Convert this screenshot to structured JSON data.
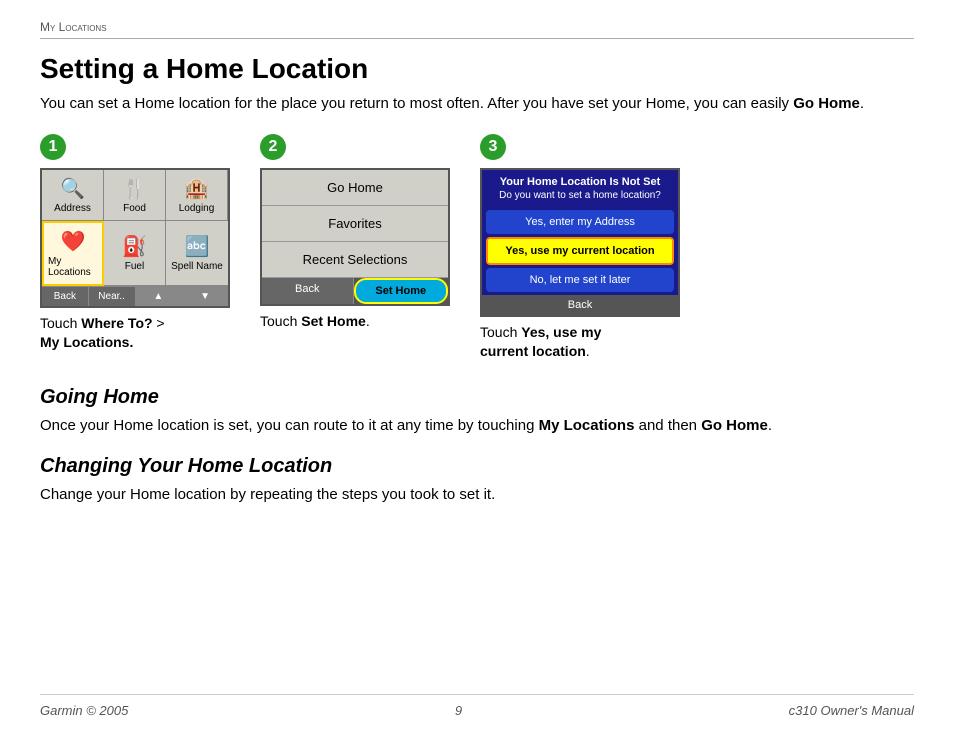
{
  "breadcrumb": "My Locations",
  "title": "Setting a Home Location",
  "intro": "You can set a Home location for the place you return to most often. After you have set your Home, you can easily ",
  "intro_bold": "Go Home",
  "intro_end": ".",
  "steps": [
    {
      "number": "1",
      "caption_normal": "Touch ",
      "caption_bold": "Where To?",
      "caption_middle": " > ",
      "caption_bold2": "My Locations.",
      "caption_bold2_suffix": ""
    },
    {
      "number": "2",
      "caption_normal": "Touch ",
      "caption_bold": "Set Home",
      "caption_end": "."
    },
    {
      "number": "3",
      "caption_normal": "Touch ",
      "caption_bold": "Yes, use my current location",
      "caption_end": "."
    }
  ],
  "screen1": {
    "cells": [
      {
        "label": "Address",
        "icon": "🔍"
      },
      {
        "label": "Food",
        "icon": "🍴"
      },
      {
        "label": "Lodging",
        "icon": "🏨"
      },
      {
        "label": "My Locations",
        "icon": "❤️",
        "selected": true
      },
      {
        "label": "Fuel",
        "icon": "⛽"
      },
      {
        "label": "Spell Name",
        "icon": "📝"
      }
    ],
    "buttons": [
      "Back",
      "Near..",
      "▲",
      "▼"
    ]
  },
  "screen2": {
    "menu_items": [
      "Go Home",
      "Favorites",
      "Recent Selections"
    ],
    "buttons": [
      "Back",
      "Set Home"
    ]
  },
  "screen3": {
    "title_line1": "Your Home Location Is Not Set",
    "title_line2": "Do you want to set a home location?",
    "options": [
      {
        "label": "Yes, enter my Address",
        "style": "blue"
      },
      {
        "label": "Yes, use my current location",
        "style": "highlight"
      },
      {
        "label": "No, let me set it later",
        "style": "dark"
      }
    ],
    "back_btn": "Back"
  },
  "going_home": {
    "heading": "Going Home",
    "text_start": "Once your Home location is set, you can route to it at any time by touching ",
    "bold1": "My Locations",
    "text_mid": " and then ",
    "bold2": "Go Home",
    "text_end": "."
  },
  "changing_home": {
    "heading": "Changing Your Home Location",
    "text": "Change your Home location by repeating the steps you took to set it."
  },
  "footer": {
    "left": "Garmin © 2005",
    "center": "9",
    "right": "c310 Owner's Manual"
  }
}
